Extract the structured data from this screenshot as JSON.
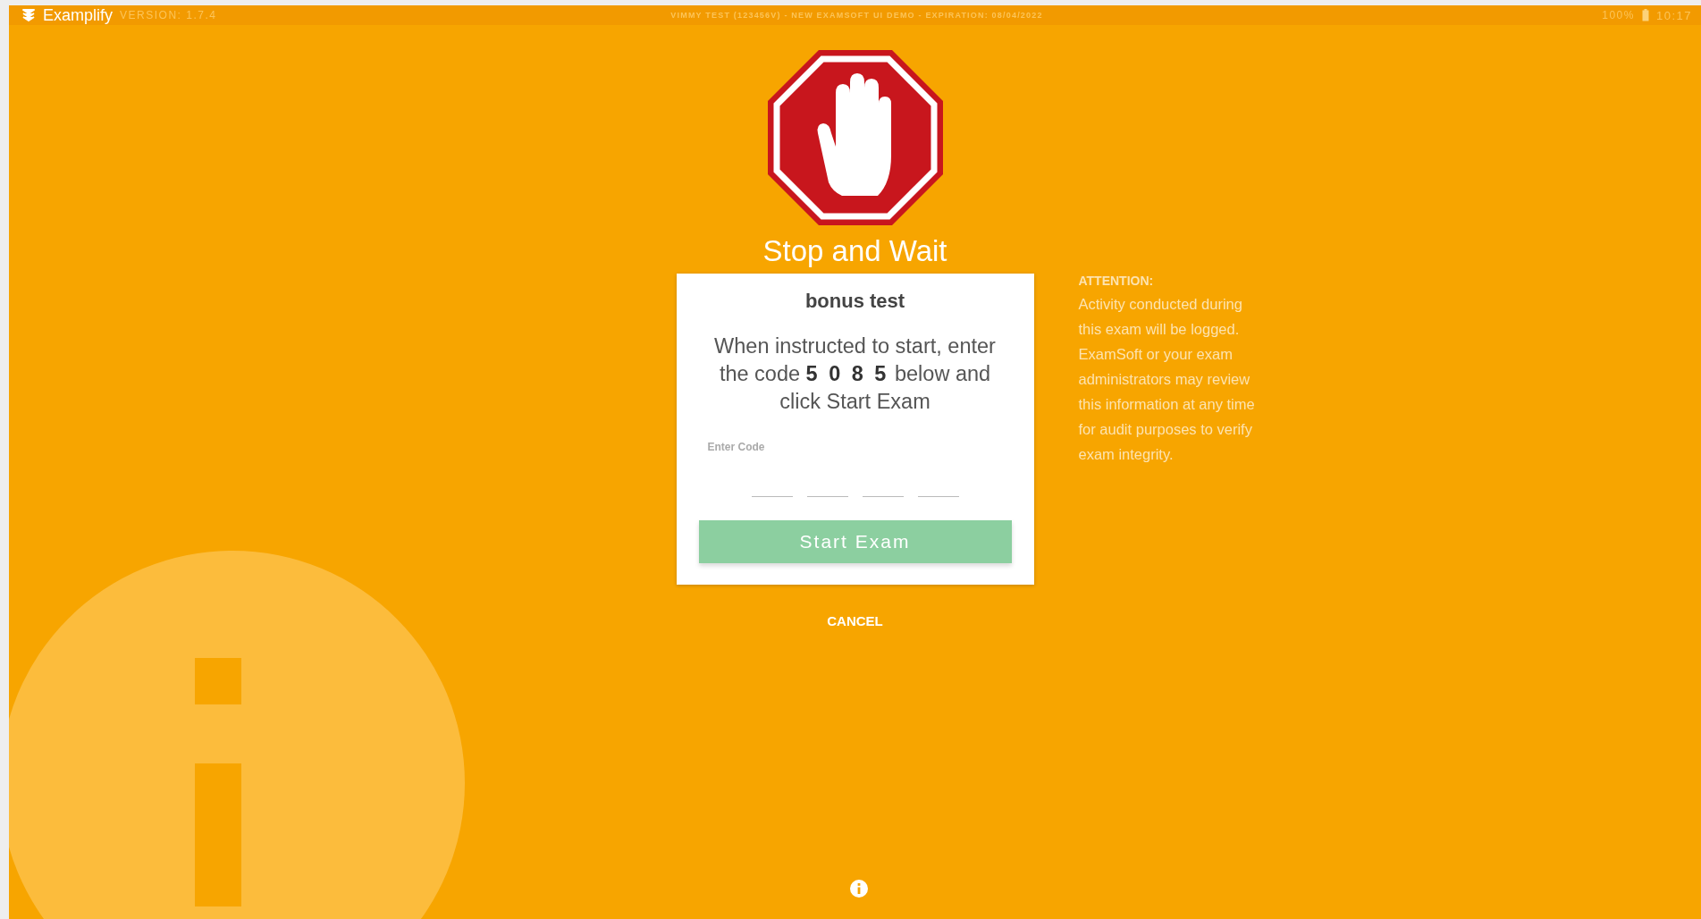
{
  "top_bar": {
    "app_name": "Examplify",
    "version": "VERSION: 1.7.4",
    "exam_info": "VIMMY TEST (123456V) - NEW EXAMSOFT UI DEMO - EXPIRATION: 08/04/2022",
    "battery": "100%",
    "time": "10:17"
  },
  "heading": "Stop and Wait",
  "card": {
    "title": "bonus test",
    "instruction": "When instructed to start, enter the code **5 0 8 5** below and click Start Exam",
    "code_label": "Enter Code",
    "code_fields": [
      {
        "kind": "digit"
      },
      {
        "kind": "digit"
      },
      {
        "kind": "digit"
      },
      {
        "kind": "digit"
      }
    ],
    "start_button": {
      "label": "Start Exam",
      "disabled": true
    }
  },
  "cancel": "CANCEL",
  "attention": {
    "title": "ATTENTION:",
    "text": "Activity conducted during this exam will be logged. ExamSoft or your exam administrators may review this information at any time for audit purposes to verify exam integrity."
  }
}
